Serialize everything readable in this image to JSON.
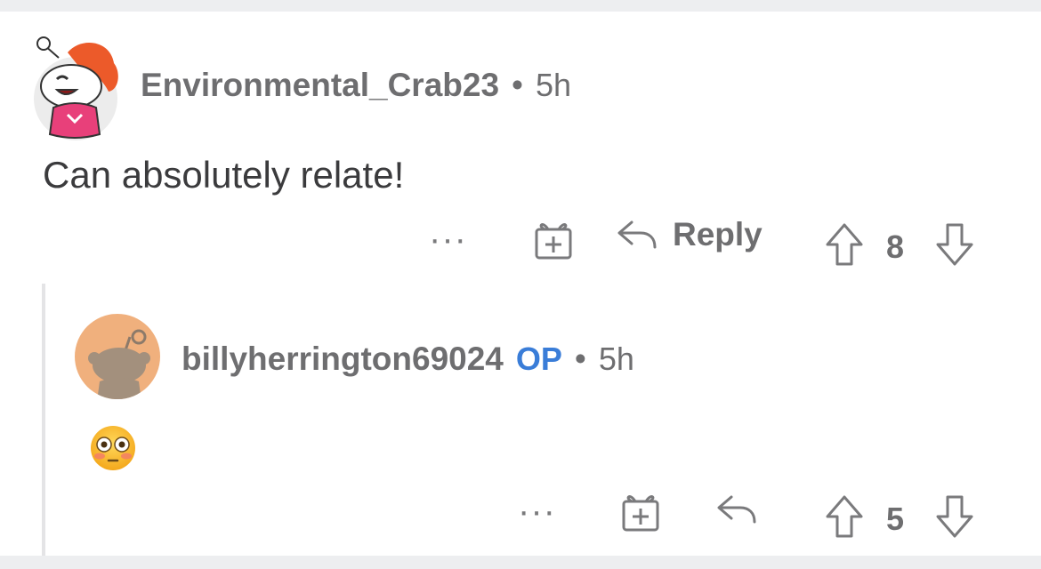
{
  "comments": [
    {
      "username": "Environmental_Crab23",
      "separator": "•",
      "time": "5h",
      "body": "Can absolutely relate!",
      "actions": {
        "more_label": "···",
        "gift_icon": "gift-icon",
        "reply_icon": "reply-arrow-icon",
        "reply_label": "Reply",
        "upvote_icon": "arrow-up-icon",
        "score": "8",
        "downvote_icon": "arrow-down-icon"
      }
    },
    {
      "username": "billyherrington69024",
      "op_badge": "OP",
      "separator": "•",
      "time": "5h",
      "body_emoji": "flushed-face-emoji",
      "actions": {
        "more_label": "···",
        "gift_icon": "gift-icon",
        "reply_icon": "reply-arrow-icon",
        "upvote_icon": "arrow-up-icon",
        "score": "5",
        "downvote_icon": "arrow-down-icon"
      }
    }
  ],
  "colors": {
    "background": "#edeef0",
    "card": "#ffffff",
    "text_muted": "#6e6e70",
    "text_body": "#3b3b3d",
    "op_badge": "#3a7dd8",
    "thread_line": "#e4e4e6",
    "avatar2_bg": "#f0b07d"
  }
}
